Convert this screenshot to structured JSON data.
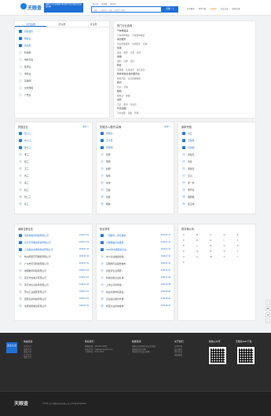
{
  "header": {
    "logo_text": "天眼查",
    "logo_sub": "TianYanCha.com",
    "ad_text": "国家中小企业发展子基金旗下官方备案企业征信机构",
    "search_tabs": [
      "查公司",
      "查老板",
      "查关系"
    ],
    "search_placeholder": "请输入公司名称、老板、品牌等关键词",
    "search_button": "天眼一下",
    "nav": [
      "企业服务",
      "APP下载",
      "开通VIP",
      "企业认证",
      "登录/注册"
    ]
  },
  "today_new": {
    "title": "今日注册",
    "tabs": [
      "今日注册",
      "周注册",
      "月注册"
    ],
    "items": [
      "招商银行",
      "服装业",
      "招商局",
      "科技类",
      "电商平台",
      "装饰业",
      "零售业",
      "互联网",
      "文化传媒",
      "广告业"
    ]
  },
  "categories": {
    "title": "热门行业查询",
    "groups": [
      {
        "h": "汽车制造业",
        "items": [
          "汽车零件制造",
          "汽车整车制造"
        ]
      },
      {
        "h": "商务服务",
        "items": [
          "企业管理服务",
          "法律服务",
          "咨询"
        ]
      },
      {
        "h": "批发",
        "items": [
          "食品",
          "服饰",
          "五金",
          "建材"
        ]
      },
      {
        "h": "金融",
        "items": [
          "保险",
          "证券",
          "银行"
        ]
      },
      {
        "h": "软件",
        "items": [
          "互联网",
          "信息技术",
          "电子商务"
        ]
      },
      {
        "h": "软件和信息技术服务业",
        "items": [
          "软件开发",
          "信息系统集成"
        ]
      },
      {
        "h": "教育",
        "items": [
          "培训",
          "学前"
        ]
      },
      {
        "h": "餐饮",
        "items": [
          "餐饮业",
          "快餐"
        ]
      },
      {
        "h": "零售",
        "items": [
          "百货",
          "超市",
          "专卖店"
        ]
      },
      {
        "h": "环境治理",
        "items": [
          "污水处理",
          "固废",
          "环保"
        ]
      }
    ]
  },
  "hot_company": {
    "title": "热搜企业",
    "more": "更多>>",
    "items": [
      "张小三",
      "刘小三",
      "张大三",
      "李三",
      "张三",
      "王三",
      "刘三",
      "黄三",
      "赵三",
      "张二三",
      "孙三"
    ]
  },
  "hot_people": {
    "title": "热搜法人/股东/高管",
    "more": "更多>>",
    "items": [
      "张明亮",
      "王大伟",
      "刘晓明",
      "张伟",
      "李明",
      "赵刚",
      "陈伟",
      "刘洋",
      "王磊",
      "张勇",
      "杨静"
    ]
  },
  "hot_topics": {
    "title": "最新专题",
    "items": [
      "马云",
      "王健林",
      "马化腾",
      "刘强东",
      "雷军",
      "李彦宏",
      "王兴",
      "张一鸣",
      "李开复",
      "董明珠",
      "任正非"
    ]
  },
  "latest_reg": {
    "title": "最新注册企业",
    "items": [
      {
        "name": "深圳市腾讯科技有限公司",
        "date": "2018-07-19"
      },
      {
        "name": "北京字节跳动科技有限公司",
        "date": "2018-07-19"
      },
      {
        "name": "上海拼多多网络科技有限公司",
        "date": "2018-07-19"
      },
      {
        "name": "杭州阿里巴巴网络有限公司",
        "date": "2018-07-19"
      },
      {
        "name": "广州市天河科技有限公司",
        "date": "2018-07-19"
      },
      {
        "name": "成都数字科技有限公司",
        "date": "2018-07-19"
      },
      {
        "name": "武汉光谷电子有限公司",
        "date": "2018-07-19"
      },
      {
        "name": "南京市信息技术有限公司",
        "date": "2018-07-19"
      },
      {
        "name": "苏州工业园区有限公司",
        "date": "2018-07-19"
      },
      {
        "name": "西安高新科技有限公司",
        "date": "2018-07-19"
      },
      {
        "name": "重庆智能制造有限公司",
        "date": "2018-07-19"
      }
    ]
  },
  "hot_events": {
    "title": "热点事件",
    "items": [
      {
        "name": "「天眼查」官方发布…",
        "date": "2018-07-17"
      },
      {
        "name": "大数据看企业发展…",
        "date": "2018-07-13"
      },
      {
        "name": "2018年中国民营企业…",
        "date": "2018-07-13"
      },
      {
        "name": "中小企业融资新政…",
        "date": "2018-07-12"
      },
      {
        "name": "互联网行业报告发布…",
        "date": "2018-07-10"
      },
      {
        "name": "新经济企业调研…",
        "date": "2018-07-03"
      },
      {
        "name": "科技创新企业名单…",
        "date": "2018-07-03"
      },
      {
        "name": "上市公司半年报…",
        "date": "2018-06-28"
      },
      {
        "name": "商业信用体系建设…",
        "date": "2018-06-28"
      },
      {
        "name": "企业征信服务升级…",
        "date": "2018-06-26"
      },
      {
        "name": "年度企业榜单发布…",
        "date": "2018-06-22"
      }
    ]
  },
  "letters": {
    "title": "首字母公司",
    "items": [
      "A",
      "B",
      "C",
      "D",
      "E",
      "F",
      "G",
      "H",
      "I",
      "J",
      "K",
      "L",
      "M",
      "N",
      "O",
      "P",
      "Q",
      "R",
      "S",
      "T",
      "U",
      "V",
      "W",
      "X",
      "Y",
      "Z"
    ]
  },
  "footer": {
    "badge": "企业认证",
    "cols": [
      {
        "h": "快速链接",
        "items": [
          "公司大全",
          "品牌大全",
          "老板大全",
          "行业大全",
          "地区大全"
        ]
      },
      {
        "h": "联系我们",
        "items": [
          "客服热线：400-871-6266",
          "商务合作：bd@tianyancha.com",
          "工作时间：9:00-18:00"
        ]
      },
      {
        "h": "数据来源",
        "items": [
          "国家企业信用信息公示系统",
          "中国裁判文书网",
          "中国执行信息公开网"
        ]
      },
      {
        "h": "关于我们",
        "items": [
          "公司介绍",
          "加入我们",
          "用户协议",
          "隐私政策"
        ]
      }
    ],
    "qr1": "微信公众号",
    "qr2": "天眼查APP下载",
    "copyright": "©2018 北京天眼查科技有限公司 京ICP备18011930号",
    "bottom_logo": "天眼查"
  }
}
